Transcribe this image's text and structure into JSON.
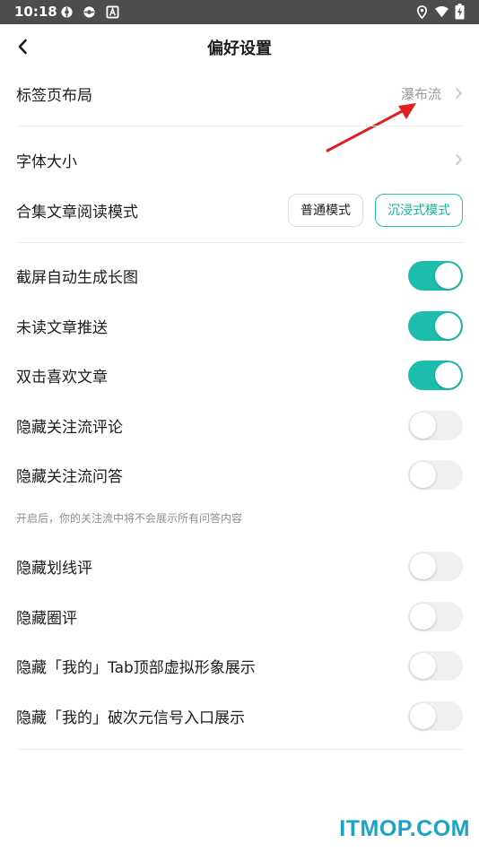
{
  "status_bar": {
    "time": "10:18",
    "icons": [
      "gear-sync-icon",
      "gear-sync-icon",
      "a-notification-icon",
      "location-icon",
      "wifi-icon",
      "battery-charging-icon"
    ]
  },
  "nav": {
    "title": "偏好设置",
    "back_icon": "chevron-left-icon"
  },
  "settings": {
    "tab_layout": {
      "label": "标签页布局",
      "value": "瀑布流"
    },
    "font_size": {
      "label": "字体大小"
    },
    "reading_mode": {
      "label": "合集文章阅读模式",
      "options": [
        "普通模式",
        "沉浸式模式"
      ],
      "selected": "沉浸式模式"
    },
    "toggles": [
      {
        "label": "截屏自动生成长图",
        "on": true
      },
      {
        "label": "未读文章推送",
        "on": true
      },
      {
        "label": "双击喜欢文章",
        "on": true
      },
      {
        "label": "隐藏关注流评论",
        "on": false
      },
      {
        "label": "隐藏关注流问答",
        "on": false
      },
      {
        "label": "隐藏划线评",
        "on": false
      },
      {
        "label": "隐藏圈评",
        "on": false
      },
      {
        "label": "隐藏「我的」Tab顶部虚拟形象展示",
        "on": false
      },
      {
        "label": "隐藏「我的」破次元信号入口展示",
        "on": false
      }
    ],
    "hint": "开启后，你的关注流中将不会展示所有问答内容"
  },
  "colors": {
    "accent": "#1dbdad",
    "status_bar": "#4d4d4d",
    "annotation_arrow": "#e0201f",
    "watermark": "#1aa3c4"
  },
  "watermark": "ITMOP.COM"
}
